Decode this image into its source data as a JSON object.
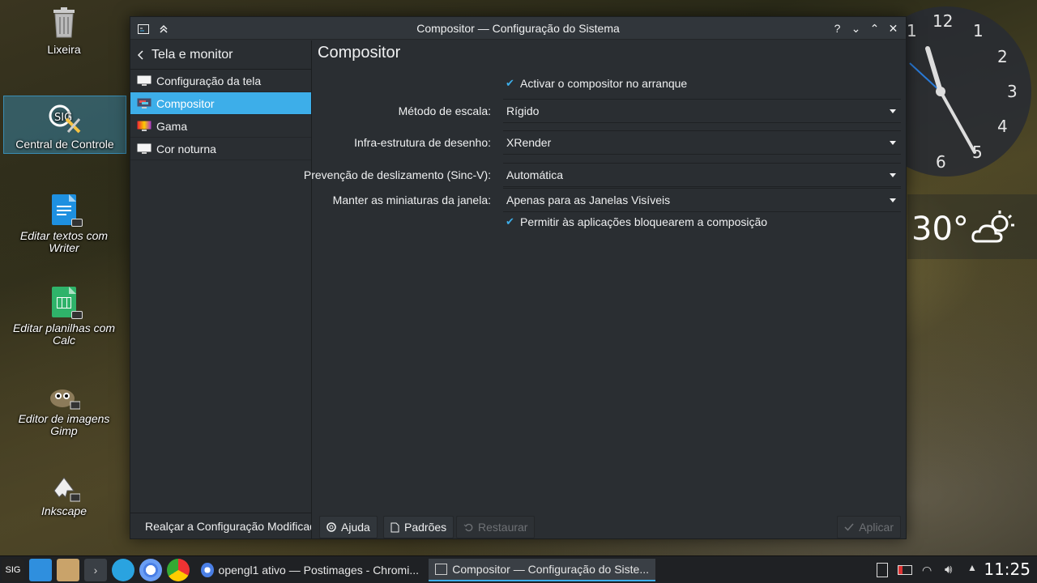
{
  "desktop": {
    "icons": [
      {
        "label": "Lixeira",
        "icon": "trash-icon"
      },
      {
        "label": "Central de Controle",
        "icon": "control-center-icon"
      },
      {
        "label": "Editar textos com Writer",
        "icon": "writer-doc-icon"
      },
      {
        "label": "Editar planilhas com Calc",
        "icon": "calc-sheet-icon"
      },
      {
        "label": "Editor de imagens Gimp",
        "icon": "gimp-icon"
      },
      {
        "label": "Inkscape",
        "icon": "inkscape-icon"
      }
    ]
  },
  "clock_widget": {
    "numbers": [
      "12",
      "1",
      "2",
      "3",
      "4",
      "5",
      "6",
      "1"
    ]
  },
  "weather_widget": {
    "temperature": "30°",
    "icon": "partly-cloudy-icon"
  },
  "window": {
    "title": "Compositor — Configuração do Sistema",
    "title_buttons": [
      "help-icon",
      "minimize-icon",
      "maximize-icon",
      "close-icon"
    ],
    "title_glyphs": {
      "help": "?",
      "minimize": "⌄",
      "maximize": "⌃",
      "close": "✕"
    },
    "sidebar": {
      "back_label": "Tela e monitor",
      "items": [
        {
          "label": "Configuração da tela",
          "icon": "monitor-icon"
        },
        {
          "label": "Compositor",
          "icon": "compositor-icon",
          "active": true
        },
        {
          "label": "Gama",
          "icon": "gamma-icon"
        },
        {
          "label": "Cor noturna",
          "icon": "monitor-icon"
        }
      ],
      "bottom_button": "Realçar a Configuração Modificada"
    },
    "main": {
      "title": "Compositor",
      "enable_on_startup": "Activar o compositor no arranque",
      "fields": [
        {
          "label": "Método de escala:",
          "value": "Rígido"
        },
        {
          "label": "Infra-estrutura de desenho:",
          "value": "XRender"
        },
        {
          "label": "Prevenção de deslizamento (Sinc-V):",
          "value": "Automática"
        },
        {
          "label": "Manter as miniaturas da janela:",
          "value": "Apenas para as Janelas Visíveis"
        }
      ],
      "allow_block": "Permitir às aplicações bloquearem a composição"
    },
    "footer": {
      "help": "Ajuda",
      "defaults": "Padrões",
      "reset": "Restaurar",
      "apply": "Aplicar"
    }
  },
  "taskbar": {
    "tasks": [
      {
        "label": "opengl1 ativo — Postimages - Chromi...",
        "icon": "chromium-icon"
      },
      {
        "label": "Compositor  — Configuração do Siste...",
        "icon": "settings-icon",
        "active": true
      }
    ],
    "time": "11:25"
  }
}
